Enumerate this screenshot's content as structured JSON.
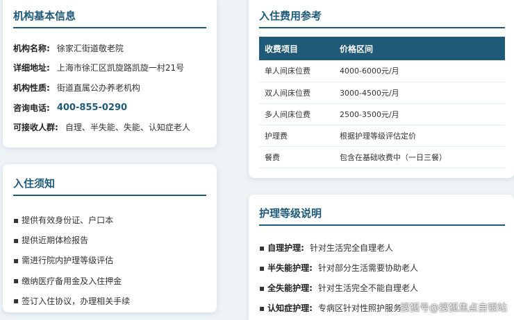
{
  "basic_info": {
    "title": "机构基本信息",
    "rows": [
      {
        "label": "机构名称:",
        "value": "徐家汇街道敬老院"
      },
      {
        "label": "详细地址:",
        "value": "上海市徐汇区凯旋路凯旋一村21号"
      },
      {
        "label": "机构性质:",
        "value": "街道直属公办养老机构"
      },
      {
        "label": "咨询电话:",
        "value": "400-855-0290"
      },
      {
        "label": "可接收人群:",
        "value": "自理、半失能、失能、认知症老人"
      }
    ]
  },
  "notice": {
    "title": "入住须知",
    "bullet": "▪",
    "items": [
      "提供有效身份证、户口本",
      "提供近期体检报告",
      "需进行院内护理等级评估",
      "缴纳医疗备用金及入住押金",
      "签订入住协议，办理相关手续"
    ]
  },
  "fees": {
    "title": "入住费用参考",
    "headers": [
      "收费项目",
      "价格区间"
    ],
    "rows": [
      [
        "单人间床位费",
        "4000-6000元/月"
      ],
      [
        "双人间床位费",
        "3000-4500元/月"
      ],
      [
        "多人间床位费",
        "2500-3500元/月"
      ],
      [
        "护理费",
        "根据护理等级评估定价"
      ],
      [
        "餐费",
        "包含在基础收费中（一日三餐）"
      ]
    ]
  },
  "levels": {
    "title": "护理等级说明",
    "bullet": "▪",
    "items": [
      {
        "label": "自理护理:",
        "desc": "针对生活完全自理老人"
      },
      {
        "label": "半失能护理:",
        "desc": "针对部分生活需要协助老人"
      },
      {
        "label": "全失能护理:",
        "desc": "针对生活完全不能自理老人"
      },
      {
        "label": "认知症护理:",
        "desc": "专病区针对性照护服务"
      }
    ]
  },
  "watermark": "搜狐号@搜狐焦点自银站",
  "colors": {
    "accent": "#1f5a78",
    "background": "#eef3f6"
  }
}
